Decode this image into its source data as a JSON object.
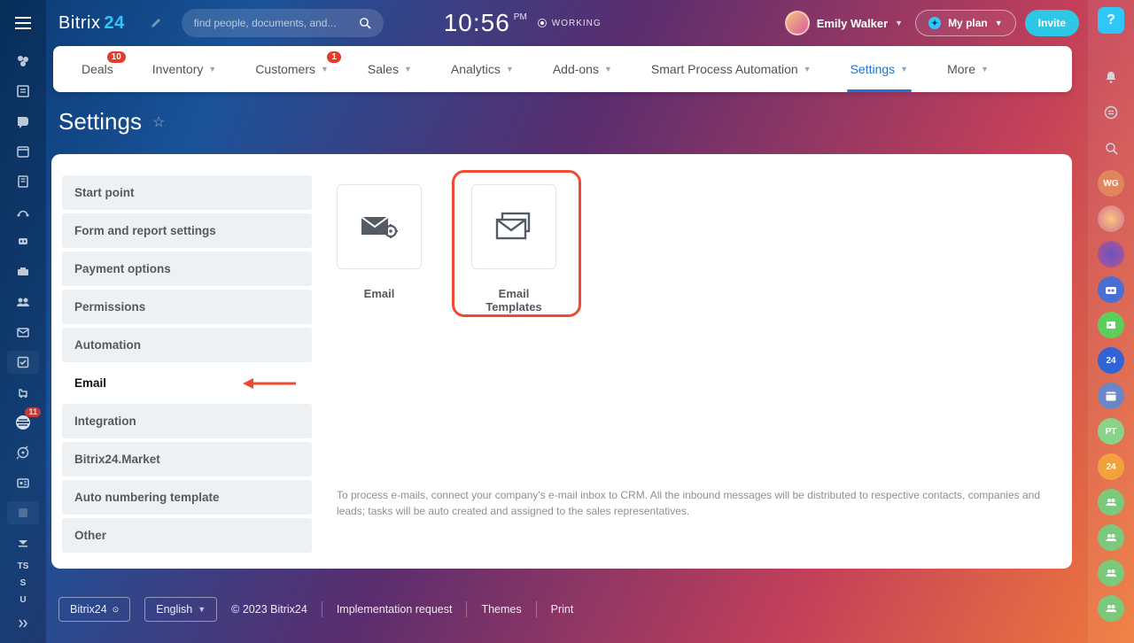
{
  "brand": {
    "name": "Bitrix",
    "suffix": "24"
  },
  "search": {
    "placeholder": "find people, documents, and..."
  },
  "clock": {
    "time": "10:56",
    "suffix": "PM",
    "status": "WORKING"
  },
  "user": {
    "name": "Emily Walker"
  },
  "buttons": {
    "myplan": "My plan",
    "invite": "Invite"
  },
  "nav": {
    "items": [
      {
        "label": "Deals",
        "badge": "10"
      },
      {
        "label": "Inventory"
      },
      {
        "label": "Customers",
        "badge": "1"
      },
      {
        "label": "Sales"
      },
      {
        "label": "Analytics"
      },
      {
        "label": "Add-ons"
      },
      {
        "label": "Smart Process Automation"
      },
      {
        "label": "Settings",
        "active": true
      },
      {
        "label": "More"
      }
    ]
  },
  "page": {
    "title": "Settings"
  },
  "sidemenu": {
    "items": [
      "Start point",
      "Form and report settings",
      "Payment options",
      "Permissions",
      "Automation",
      "Email",
      "Integration",
      "Bitrix24.Market",
      "Auto numbering template",
      "Other"
    ],
    "active_index": 5
  },
  "tiles": {
    "email": "Email",
    "email_templates": "Email Templates"
  },
  "description": "To process e-mails, connect your company's e-mail inbox to CRM. All the inbound messages will be distributed to respective contacts, companies and leads; tasks will be auto created and assigned to the sales representatives.",
  "footer": {
    "brand": "Bitrix24",
    "lang": "English",
    "copyright": "© 2023 Bitrix24",
    "links": [
      "Implementation request",
      "Themes",
      "Print"
    ]
  },
  "leftbar_badge": "11",
  "rightbar": {
    "wg": "WG",
    "b24": "24",
    "pt": "PT"
  }
}
